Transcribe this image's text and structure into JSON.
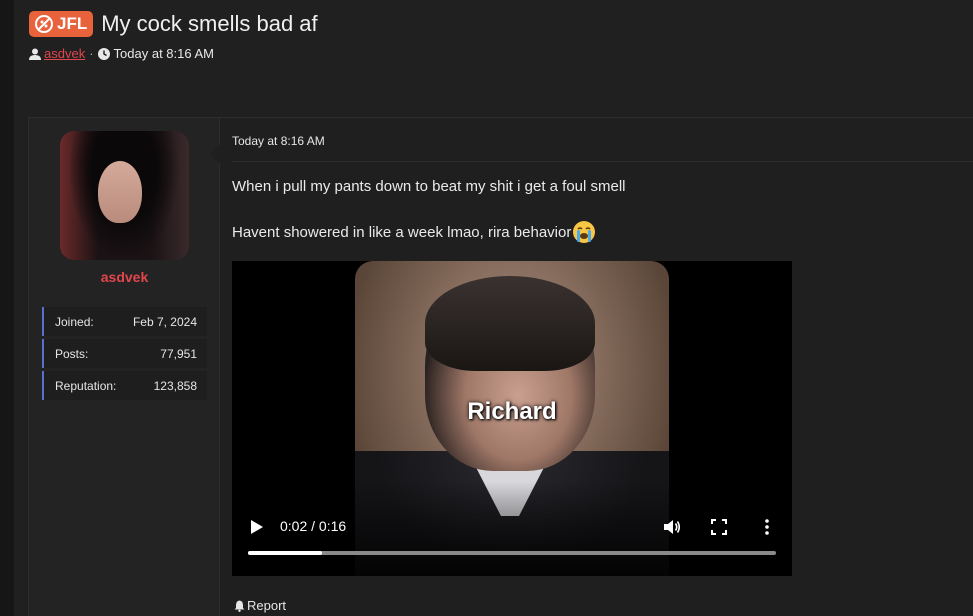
{
  "thread": {
    "prefix": "JFL",
    "title": "My cock smells bad af",
    "author": "asdvek",
    "separator": "·",
    "time": "Today at 8:16 AM"
  },
  "user": {
    "name": "asdvek",
    "stats": [
      {
        "label": "Joined:",
        "value": "Feb 7, 2024"
      },
      {
        "label": "Posts:",
        "value": "77,951"
      },
      {
        "label": "Reputation:",
        "value": "123,858"
      }
    ]
  },
  "post": {
    "date": "Today at 8:16 AM",
    "line1": "When i pull my pants down to beat my shit i get a foul smell",
    "line2": "Havent showered in like a week lmao, rira behavior",
    "emoji": "loudly-crying-face",
    "report_label": "Report"
  },
  "video": {
    "caption": "Richard",
    "time": "0:02 / 0:16",
    "progress": 0.14
  },
  "colors": {
    "accent_red": "#e0474c",
    "prefix_orange": "#e8633c",
    "stat_border": "#5a6fd0"
  }
}
